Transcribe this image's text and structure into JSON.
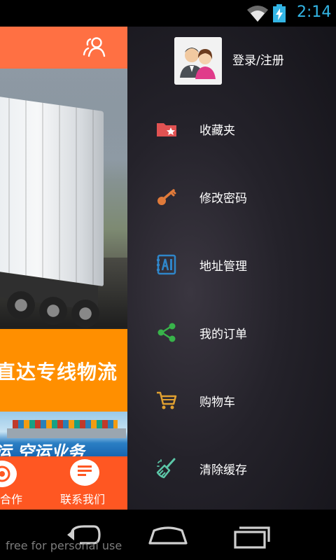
{
  "status_bar": {
    "time": "2:14",
    "icons": [
      "wifi-icon",
      "battery-charging-icon"
    ],
    "time_color": "#33b5e5"
  },
  "main": {
    "header_color": "#ff7043",
    "header_icon": "user-group-icon",
    "banner_indicator": {
      "count": 3,
      "active_index": 0
    },
    "promo_text": "直达专线物流",
    "shipping_text": "运 空运业务",
    "bottom_tabs": [
      {
        "label": "合作",
        "icon": "handshake-icon"
      },
      {
        "label": "联系我们",
        "icon": "chat-icon"
      }
    ]
  },
  "drawer": {
    "login_label": "登录/注册",
    "avatar_icon": "users-avatar-icon",
    "items": [
      {
        "label": "收藏夹",
        "icon": "favorites-folder-icon",
        "color": "#e05252"
      },
      {
        "label": "修改密码",
        "icon": "key-icon",
        "color": "#e07a3a"
      },
      {
        "label": "地址管理",
        "icon": "address-book-icon",
        "color": "#2f86c9"
      },
      {
        "label": "我的订单",
        "icon": "share-icon",
        "color": "#38b34a"
      },
      {
        "label": "购物车",
        "icon": "cart-icon",
        "color": "#e0a030"
      },
      {
        "label": "清除缓存",
        "icon": "broom-icon",
        "color": "#5cc7a8"
      }
    ]
  },
  "nav_bar": {
    "buttons": [
      "back-icon",
      "home-icon",
      "recent-apps-icon"
    ],
    "watermark": "free for personal use"
  }
}
